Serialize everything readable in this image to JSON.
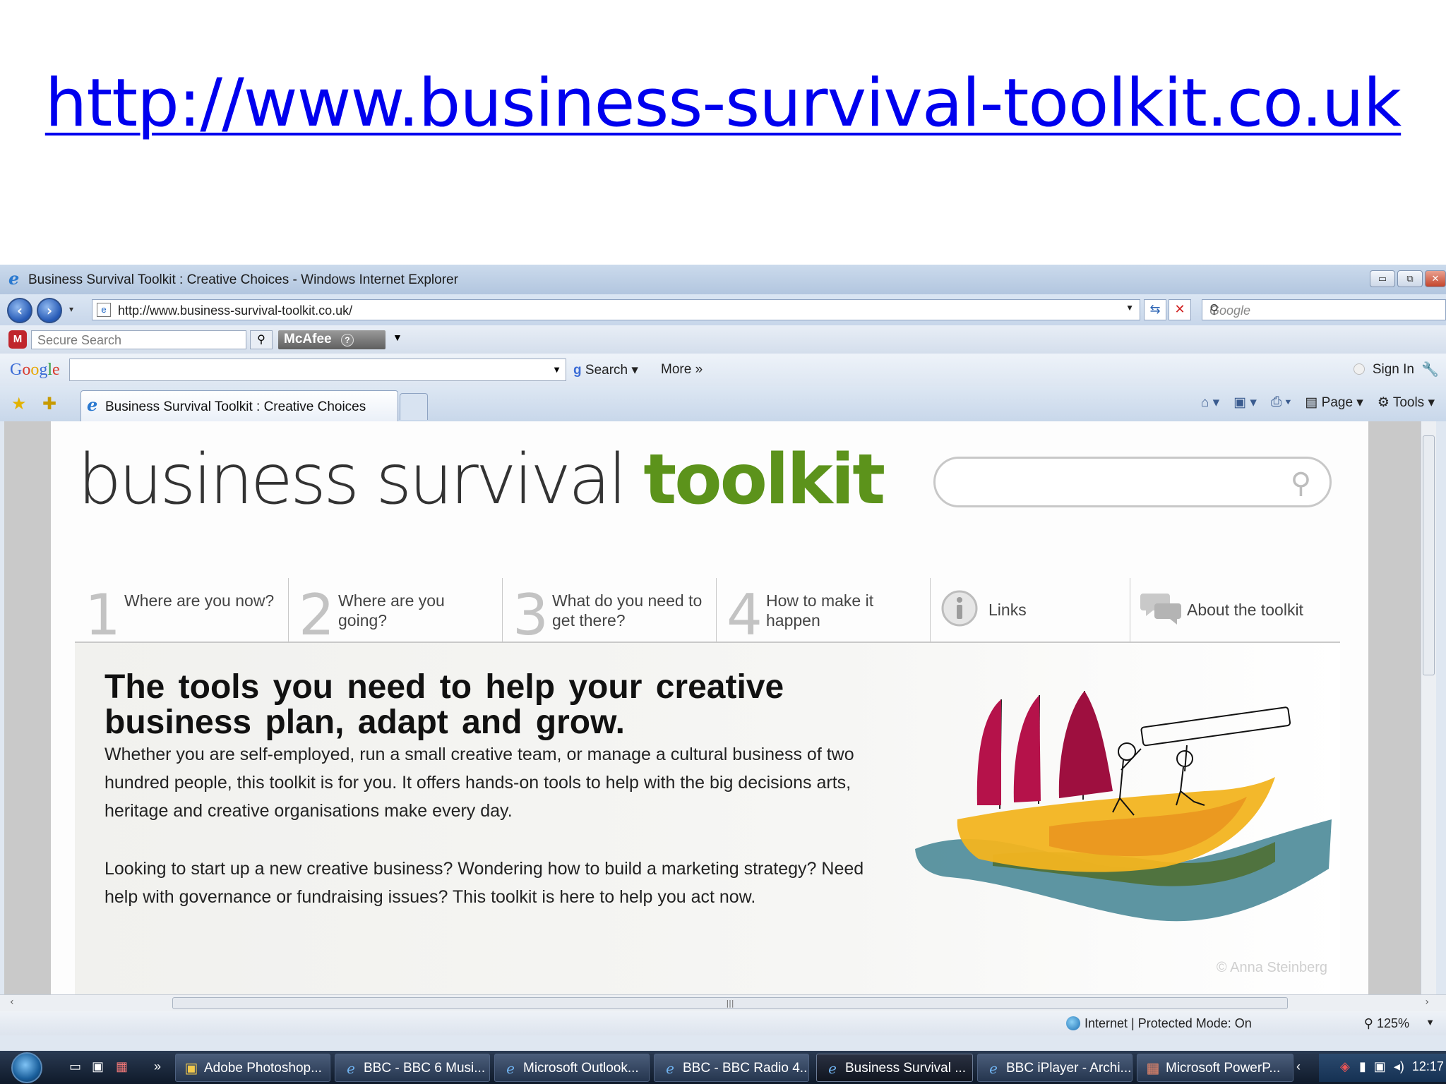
{
  "slide": {
    "title_link": "http://www.business-survival-toolkit.co.uk"
  },
  "window": {
    "title": "Business Survival Toolkit : Creative Choices - Windows Internet Explorer",
    "min_icon": "▭",
    "max_icon": "⧉",
    "close_icon": "✕"
  },
  "address_bar": {
    "url": "http://www.business-survival-toolkit.co.uk/",
    "refresh_icon": "⇆",
    "stop_icon": "✕",
    "search_placeholder": "Google"
  },
  "mcafee_bar": {
    "secure_search_placeholder": "Secure Search",
    "brand": "McAfee",
    "help_icon": "?"
  },
  "google_bar": {
    "logo": "Google",
    "search_label": "Search",
    "more_label": "More",
    "sign_in_label": "Sign In"
  },
  "tabs": {
    "active_tab_label": "Business Survival Toolkit : Creative Choices"
  },
  "command_bar": {
    "page_label": "Page",
    "tools_label": "Tools"
  },
  "site": {
    "logo_part1": "business survival ",
    "logo_part2": "toolkit",
    "nav": [
      {
        "num": "1",
        "label": "Where are you now?"
      },
      {
        "num": "2",
        "label": "Where are you going?"
      },
      {
        "num": "3",
        "label": "What do you need to get there?"
      },
      {
        "num": "4",
        "label": "How to make it happen"
      },
      {
        "label": "Links"
      },
      {
        "label": "About the toolkit"
      }
    ],
    "hero_heading": "The tools you need to help your creative business plan, adapt and grow.",
    "hero_p1": "Whether you are self-employed, run a small creative team, or manage a cultural business of two hundred people, this toolkit is for you. It offers hands-on tools to help with the big decisions arts, heritage and creative organisations make every day.",
    "hero_p2": "Looking to start up a new creative business? Wondering how to build a marketing strategy? Need help with governance or fundraising issues? This toolkit is here to help you act now.",
    "image_credit": "© Anna Steinberg"
  },
  "status_bar": {
    "zone": "Internet | Protected Mode: On",
    "zoom": "125%"
  },
  "taskbar": {
    "buttons": [
      {
        "label": "Adobe Photoshop...",
        "icon": "photoshop-icon"
      },
      {
        "label": "BBC - BBC 6 Musi...",
        "icon": "ie-icon"
      },
      {
        "label": "Microsoft Outlook...",
        "icon": "ie-icon"
      },
      {
        "label": "BBC - BBC Radio 4...",
        "icon": "ie-icon"
      },
      {
        "label": "Business Survival ...",
        "icon": "ie-icon"
      },
      {
        "label": "BBC iPlayer - Archi...",
        "icon": "ie-icon"
      },
      {
        "label": "Microsoft PowerP...",
        "icon": "powerpoint-icon"
      }
    ],
    "clock": "12:17"
  },
  "colors": {
    "link_blue": "#0000ee",
    "toolkit_green": "#5c931b",
    "sail_magenta": "#b5124a",
    "boat_yellow": "#f0b020",
    "wave_teal": "#3f7f8c"
  }
}
